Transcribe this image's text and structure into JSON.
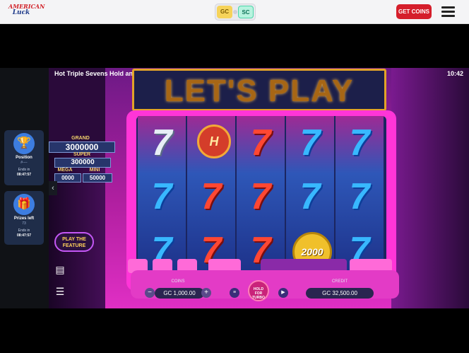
{
  "header": {
    "logo_line1": "AMERICAN",
    "logo_line2": "Luck",
    "currency_gc": "GC",
    "currency_sc": "SC",
    "get_coins_label": "GET COINS",
    "menu_icon": "hamburger-icon"
  },
  "sidebar": {
    "cards": [
      {
        "icon": "trophy-icon",
        "title": "Position",
        "subtitle": "#----",
        "ends_label": "Ends in",
        "time": "08:47:57"
      },
      {
        "icon": "gift-icon",
        "title": "Prizes left",
        "subtitle": "73",
        "ends_label": "Ends in",
        "time": "08:47:57"
      }
    ]
  },
  "game": {
    "title": "Hot Triple Sevens Hold and Win",
    "clock": "10:42",
    "marquee": "LET'S PLAY",
    "jackpots": {
      "grand_label": "GRAND",
      "grand_value": "3000000",
      "super_label": "SUPER",
      "super_value": "300000",
      "mega_label": "MEGA",
      "mega_value": "0000",
      "mini_label": "MINI",
      "mini_value": "50000"
    },
    "play_feature": "PLAY THE FEATURE",
    "reels": [
      [
        "7",
        "7",
        "7"
      ],
      [
        "H",
        "7",
        "7"
      ],
      [
        "7",
        "7",
        "7"
      ],
      [
        "7",
        "7",
        "2000"
      ],
      [
        "7",
        "7",
        "7"
      ]
    ],
    "coins_label": "COINS",
    "coins_value": "GC 1,000.00",
    "credit_label": "CREDIT",
    "credit_value": "GC 32,500.00",
    "spin_label": "HOLD FOR TURBO",
    "colors": {
      "accent_pink": "#ff35d7",
      "get_coins_red": "#d51e2b",
      "reel_blue": "#1b2560"
    }
  }
}
